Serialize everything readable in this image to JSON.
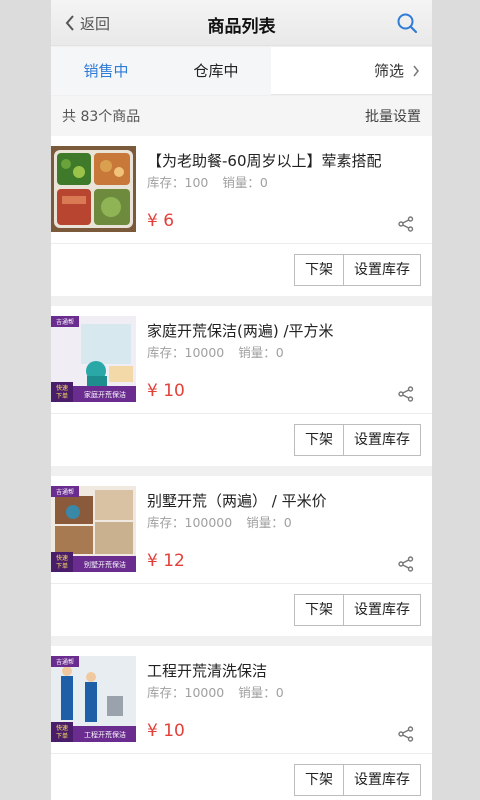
{
  "header": {
    "back_label": "返回",
    "title": "商品列表"
  },
  "tabs": {
    "on_sale": "销售中",
    "in_store": "仓库中",
    "filter": "筛选"
  },
  "summary": {
    "count_text": "共 83个商品",
    "batch_label": "批量设置"
  },
  "colors": {
    "accent": "#2f7bd6",
    "price": "#e2413a"
  },
  "products": [
    {
      "name": "【为老助餐-60周岁以上】荤素搭配",
      "stock": "库存：100",
      "sales": "销量：0",
      "price": "¥ 6",
      "off_shelf": "下架",
      "set_stock": "设置库存"
    },
    {
      "name": "家庭开荒保洁(两遍) /平方米",
      "stock": "库存：10000",
      "sales": "销量：0",
      "price": "¥ 10",
      "off_shelf": "下架",
      "set_stock": "设置库存",
      "thumb_brand": "吉通帮",
      "thumb_tag": "快速\n下单",
      "thumb_caption": "家庭开荒保洁"
    },
    {
      "name": "别墅开荒（两遍） / 平米价",
      "stock": "库存：100000",
      "sales": "销量：0",
      "price": "¥ 12",
      "off_shelf": "下架",
      "set_stock": "设置库存",
      "thumb_brand": "吉通帮",
      "thumb_tag": "快速\n下单",
      "thumb_caption": "别墅开荒保洁"
    },
    {
      "name": "工程开荒清洗保洁",
      "stock": "库存：10000",
      "sales": "销量：0",
      "price": "¥ 10",
      "off_shelf": "下架",
      "set_stock": "设置库存",
      "thumb_brand": "吉通帮",
      "thumb_tag": "快速\n下单",
      "thumb_caption": "工程开荒保洁"
    }
  ]
}
